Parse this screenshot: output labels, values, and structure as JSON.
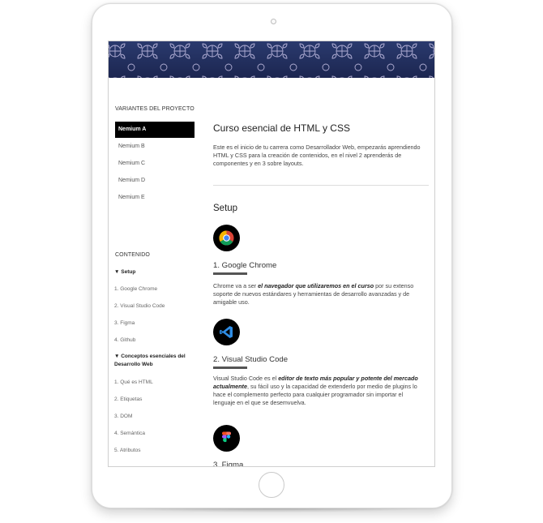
{
  "sidebar": {
    "variants_title": "VARIANTES DEL PROYECTO",
    "variants": [
      "Nemium A",
      "Nemium B",
      "Nemium C",
      "Nemium D",
      "Nemium E"
    ],
    "active_variant": "Nemium A",
    "contents_title": "CONTENIDO",
    "toc": [
      {
        "label": "▼ Setup",
        "bold": true
      },
      {
        "label": "1. Google Chrome",
        "bold": false
      },
      {
        "label": "2. Visual Studio Code",
        "bold": false
      },
      {
        "label": "3. Figma",
        "bold": false
      },
      {
        "label": "4. Github",
        "bold": false
      },
      {
        "label": "▼ Conceptos esenciales del Desarrollo Web",
        "bold": true
      },
      {
        "label": "1. Qué es HTML",
        "bold": false
      },
      {
        "label": "2. Etiquetas",
        "bold": false
      },
      {
        "label": "3. DOM",
        "bold": false
      },
      {
        "label": "4. Semántica",
        "bold": false
      },
      {
        "label": "5. Atributos",
        "bold": false
      }
    ]
  },
  "main": {
    "title": "Curso esencial de HTML y CSS",
    "intro": "Este es el inicio de tu carrera como Desarrollador Web, empezarás aprendiendo HTML y CSS para la creación de contenidos, en el nivel 2 aprenderás de componentes y en 3 sobre layouts.",
    "setup_title": "Setup",
    "tools": [
      {
        "icon": "chrome-icon",
        "title": "1. Google Chrome",
        "desc_pre": "Chrome va a ser ",
        "desc_bold": "el navegador que utilizaremos en el curso",
        "desc_post": " por su extenso soporte de nuevos estándares y herramientas de desarrollo avanzadas y de amigable uso."
      },
      {
        "icon": "vscode-icon",
        "title": "2. Visual Studio Code",
        "desc_pre": "Visual Studio Code es el ",
        "desc_bold": "editor de texto más popular y potente del mercado actualmente",
        "desc_post": ", su fácil uso y la capacidad de extenderlo por medio de plugins lo hace el complemento perfecto para cualquier programador sin importar el lenguaje en el que se desemvuelva."
      },
      {
        "icon": "figma-icon",
        "title": "3. Figma"
      }
    ]
  },
  "colors": {
    "banner": "#233160",
    "active_variant_bg": "#000000"
  }
}
